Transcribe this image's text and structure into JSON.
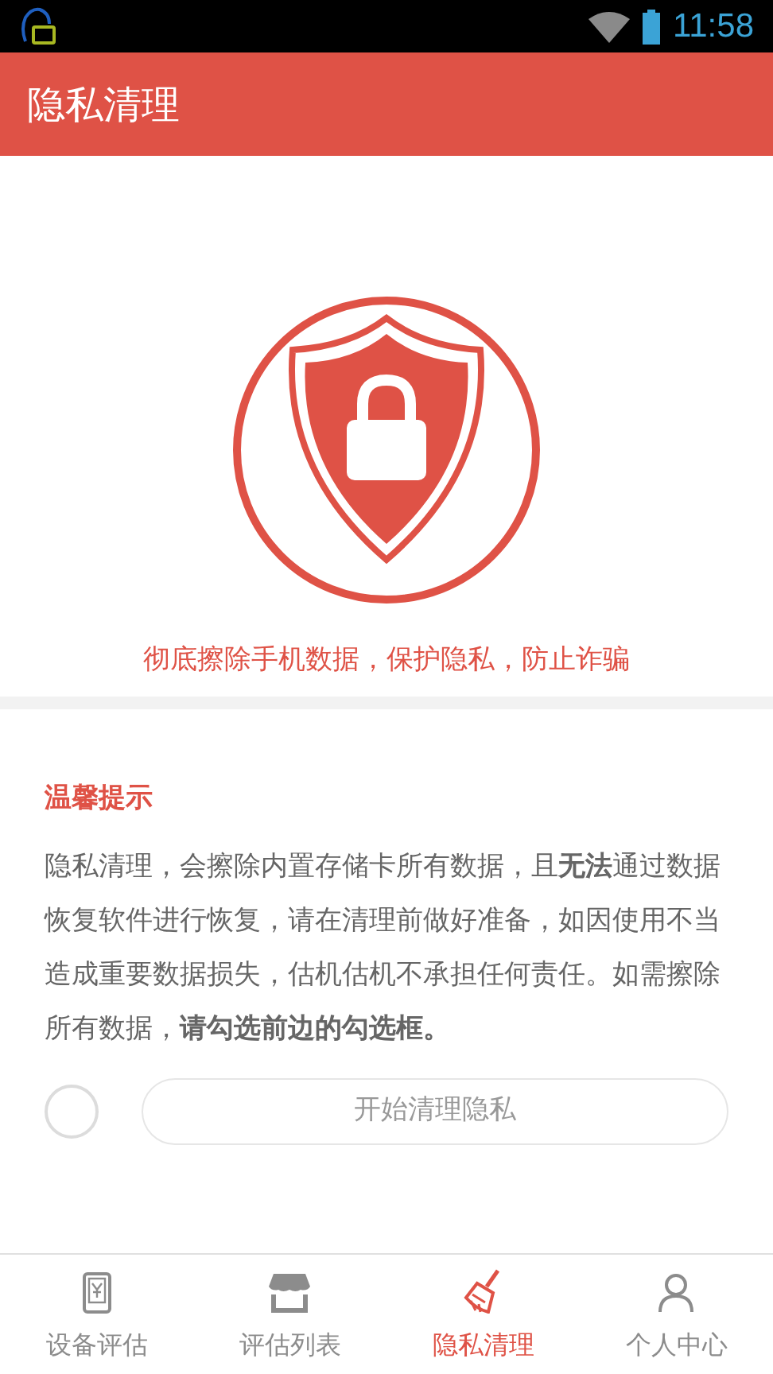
{
  "status_bar": {
    "time": "11:58"
  },
  "header": {
    "title": "隐私清理"
  },
  "hero": {
    "tagline": "彻底擦除手机数据，保护隐私，防止诈骗"
  },
  "notice": {
    "title": "温馨提示",
    "body": " 隐私清理，会擦除内置存储卡所有数据，且**无法**通过数据恢复软件进行恢复，请在清理前做好准备，如因使用不当造成重要数据损失，估机估机不承担任何责任。如需擦除所有数据，**请勾选前边的勾选框。**"
  },
  "confirm": {
    "checked": false
  },
  "start_button": {
    "label": "开始清理隐私",
    "disabled": true
  },
  "tabs": [
    {
      "label": "设备评估",
      "kind": "phone",
      "selected": false
    },
    {
      "label": "评估列表",
      "kind": "shop",
      "selected": false
    },
    {
      "label": "隐私清理",
      "kind": "broom",
      "selected": true
    },
    {
      "label": "个人中心",
      "kind": "person",
      "selected": false
    }
  ]
}
